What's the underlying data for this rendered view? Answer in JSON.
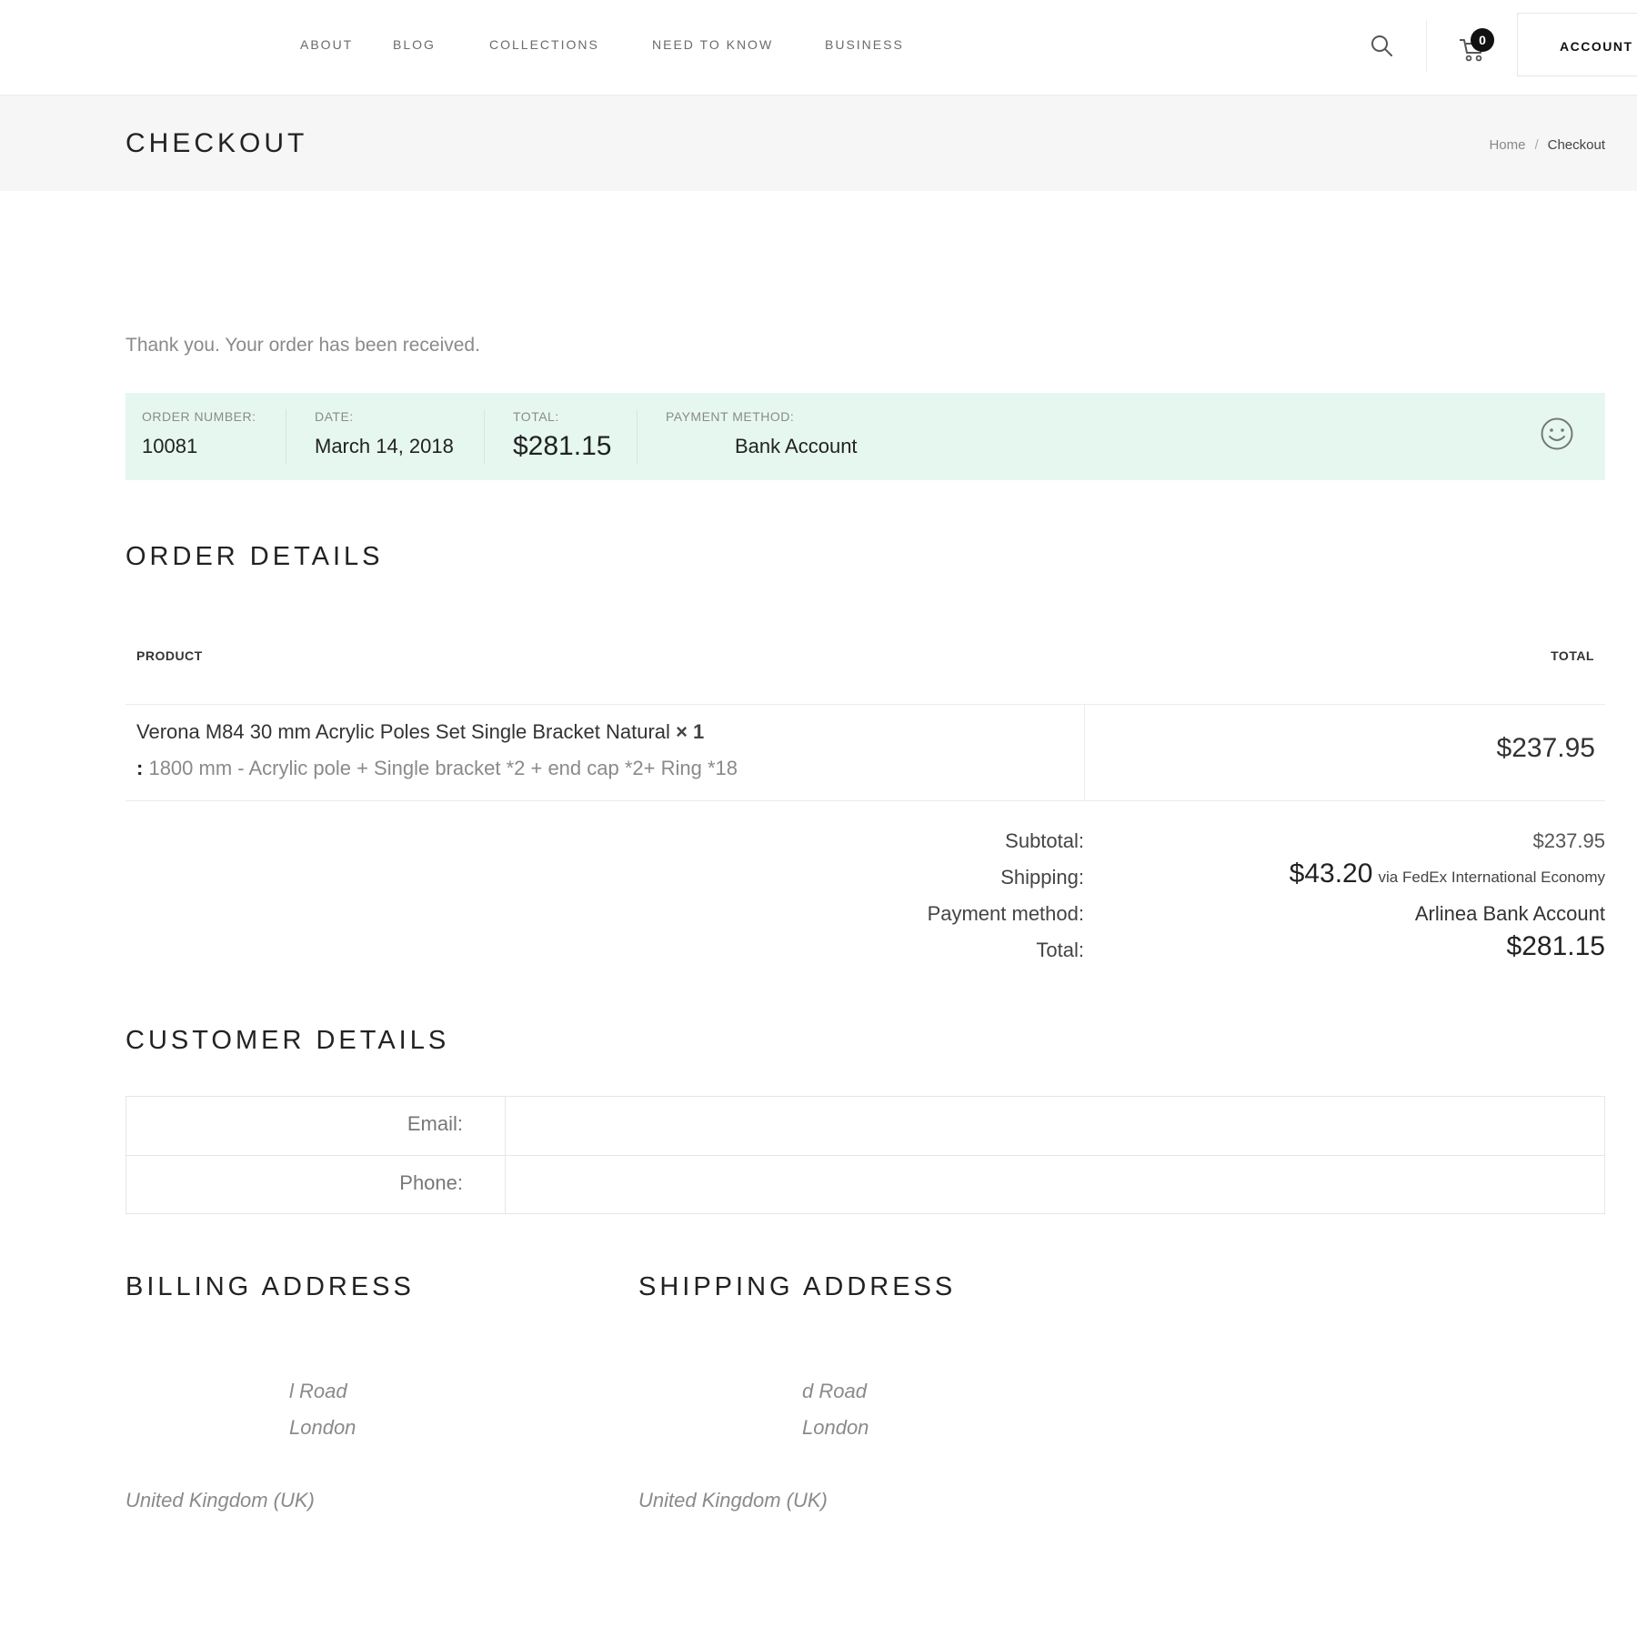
{
  "header": {
    "nav": [
      {
        "label": "ABOUT"
      },
      {
        "label": "BLOG"
      },
      {
        "label": "COLLECTIONS"
      },
      {
        "label": "NEED TO KNOW"
      },
      {
        "label": "BUSINESS"
      }
    ],
    "cart_count": "0",
    "account_label": "ACCOUNT I",
    "icons": {
      "search": "search-icon",
      "cart": "cart-icon"
    }
  },
  "page": {
    "title": "CHECKOUT",
    "breadcrumb": {
      "home": "Home",
      "separator": "/",
      "current": "Checkout"
    }
  },
  "thank_you": "Thank you. Your order has been received.",
  "overview": {
    "order_number_label": "ORDER NUMBER:",
    "order_number": "10081",
    "date_label": "DATE:",
    "date": "March 14, 2018",
    "total_label": "TOTAL:",
    "total": "$281.15",
    "payment_label": "PAYMENT METHOD:",
    "payment": "Bank Account",
    "background_color": "#e6f7f0"
  },
  "order_details": {
    "title": "ORDER DETAILS",
    "columns": {
      "product": "PRODUCT",
      "total": "TOTAL"
    },
    "item": {
      "name": "Verona M84 30 mm Acrylic Poles Set Single Bracket Natural",
      "quantity": "× 1",
      "meta_colon": ":",
      "meta": "1800 mm - Acrylic pole + Single bracket *2 + end cap *2+ Ring *18",
      "total": "$237.95"
    },
    "totals": {
      "subtotal_label": "Subtotal:",
      "subtotal": "$237.95",
      "shipping_label": "Shipping:",
      "shipping_price": "$43.20",
      "shipping_via": "via FedEx International Economy",
      "payment_label": "Payment method:",
      "payment": "Arlinea Bank Account",
      "total_label": "Total:",
      "total": "$281.15"
    }
  },
  "customer_details": {
    "title": "CUSTOMER DETAILS",
    "email_label": "Email:",
    "email": "",
    "phone_label": "Phone:",
    "phone": ""
  },
  "billing": {
    "title": "BILLING ADDRESS",
    "line1": "l Road",
    "line2": "London",
    "country": "United Kingdom (UK)"
  },
  "shipping": {
    "title": "SHIPPING ADDRESS",
    "line1": "d Road",
    "line2": "London",
    "country": "United Kingdom (UK)"
  }
}
